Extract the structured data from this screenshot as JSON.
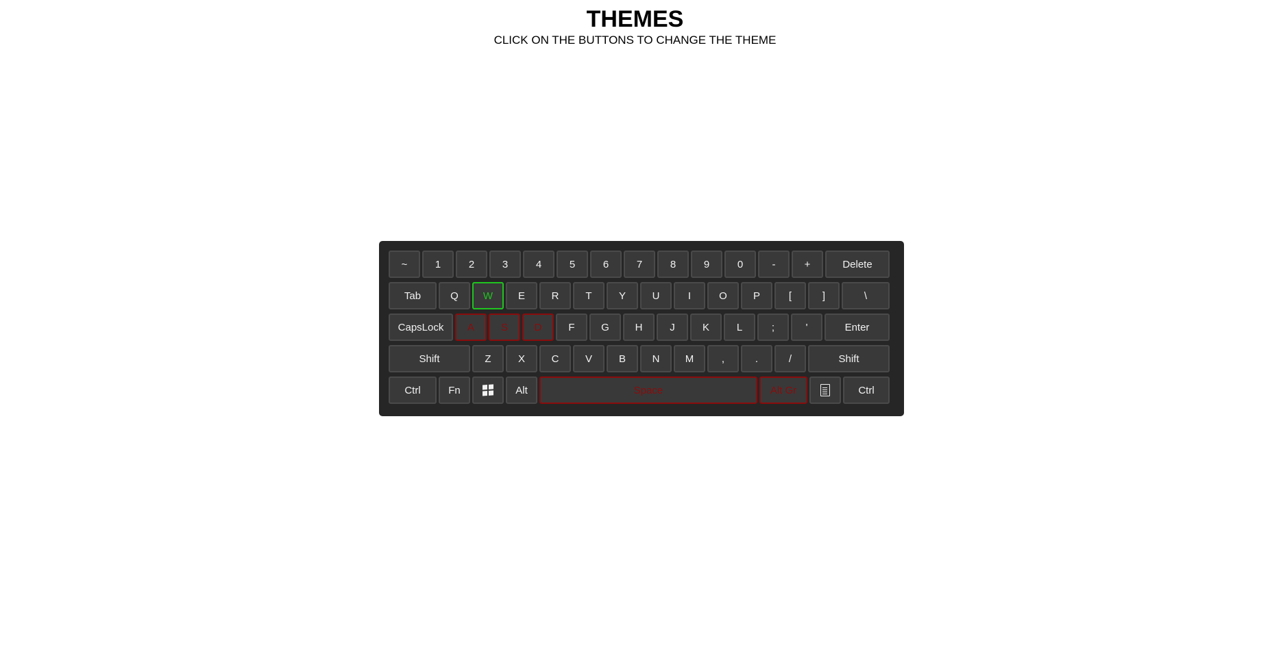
{
  "header": {
    "title": "THEMES",
    "subtitle": "CLICK ON THE BUTTONS TO CHANGE THE THEME"
  },
  "colors": {
    "keyboard_bg": "#262626",
    "key_bg": "#393939",
    "key_text": "#f2f2f2",
    "highlight_red": "#8a0c0c",
    "highlight_green": "#1fc41f"
  },
  "keyboard": {
    "row1": [
      "~",
      "1",
      "2",
      "3",
      "4",
      "5",
      "6",
      "7",
      "8",
      "9",
      "0",
      "-",
      "+",
      "Delete"
    ],
    "row2": [
      "Tab",
      "Q",
      "W",
      "E",
      "R",
      "T",
      "Y",
      "U",
      "I",
      "O",
      "P",
      "[",
      "]",
      "\\"
    ],
    "row3": [
      "CapsLock",
      "A",
      "S",
      "D",
      "F",
      "G",
      "H",
      "J",
      "K",
      "L",
      ";",
      "'",
      "Enter"
    ],
    "row4": [
      "Shift",
      "Z",
      "X",
      "C",
      "V",
      "B",
      "N",
      "M",
      ",",
      ".",
      "/",
      "Shift"
    ],
    "row5": [
      "Ctrl",
      "Fn",
      "windows-icon",
      "Alt",
      "Space",
      "Alt Gr",
      "document-icon",
      "Ctrl"
    ],
    "highlighted_keys": {
      "W": "green",
      "A": "red",
      "S": "red",
      "D": "red",
      "Space": "red",
      "Alt Gr": "red"
    }
  }
}
